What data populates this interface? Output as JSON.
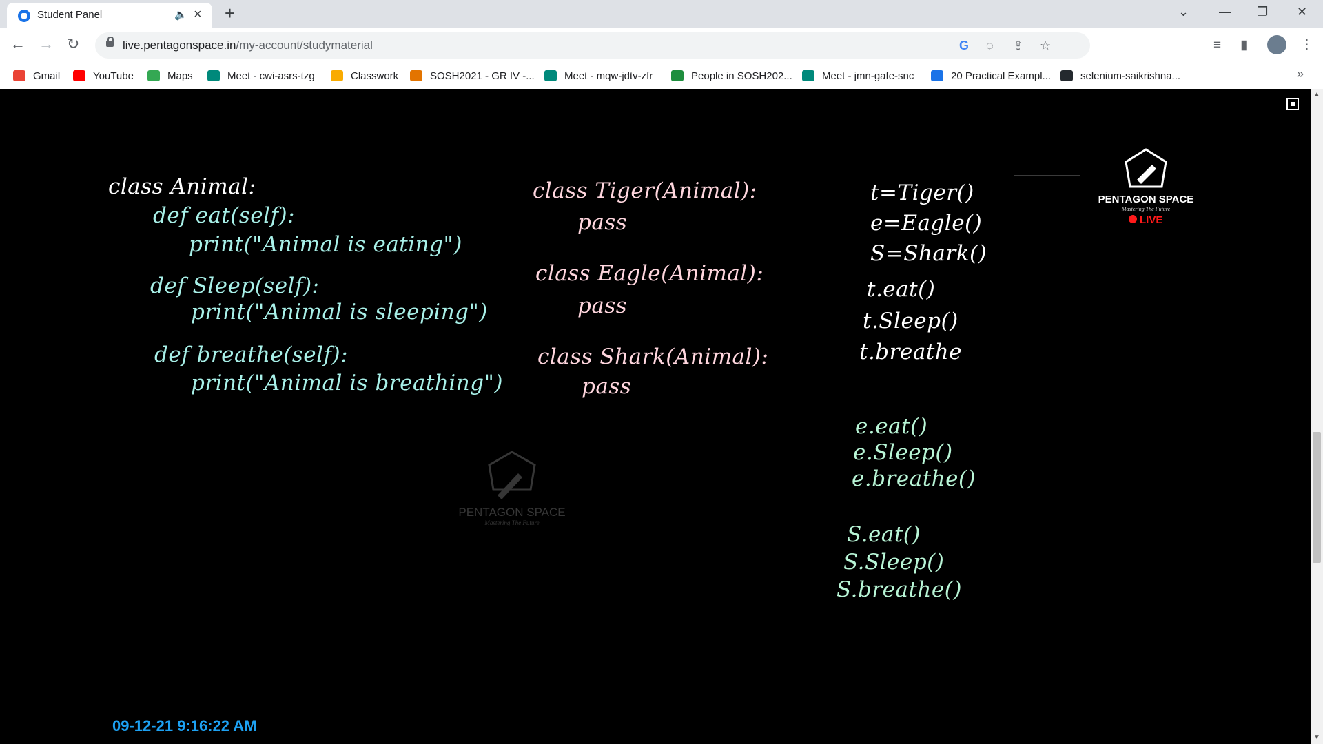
{
  "tab": {
    "title": "Student Panel"
  },
  "address_bar": {
    "domain": "live.pentagonspace.in",
    "path": "/my-account/studymaterial"
  },
  "bookmarks": [
    {
      "label": "Gmail",
      "icon": "gmail-icon",
      "color": "#ea4335"
    },
    {
      "label": "YouTube",
      "icon": "youtube-icon",
      "color": "#ff0000"
    },
    {
      "label": "Maps",
      "icon": "maps-icon",
      "color": "#34a853"
    },
    {
      "label": "Meet - cwi-asrs-tzg",
      "icon": "meet-icon",
      "color": "#00897b"
    },
    {
      "label": "Classwork",
      "icon": "classroom-icon",
      "color": "#f9ab00"
    },
    {
      "label": "SOSH2021 - GR IV -...",
      "icon": "classroom-icon",
      "color": "#e37400"
    },
    {
      "label": "Meet - mqw-jdtv-zfr",
      "icon": "meet-icon",
      "color": "#00897b"
    },
    {
      "label": "People in SOSH202...",
      "icon": "classroom-icon",
      "color": "#1e8e3e"
    },
    {
      "label": "Meet - jmn-gafe-snc",
      "icon": "meet-icon",
      "color": "#00897b"
    },
    {
      "label": "20 Practical Exampl...",
      "icon": "shield-icon",
      "color": "#1a73e8"
    },
    {
      "label": "selenium-saikrishna...",
      "icon": "github-icon",
      "color": "#24292e"
    }
  ],
  "board": {
    "col1": [
      "class Animal:",
      "def eat(self):",
      "print(\"Animal is eating\")",
      "def Sleep(self):",
      "print(\"Animal is sleeping\")",
      "def breathe(self):",
      "print(\"Animal is breathing\")"
    ],
    "col2": [
      "class Tiger(Animal):",
      "pass",
      "class Eagle(Animal):",
      "pass",
      "class Shark(Animal):",
      "pass"
    ],
    "col3": [
      "t=Tiger()",
      "e=Eagle()",
      "S=Shark()",
      "t.eat()",
      "t.Sleep()",
      "t.breathe",
      "e.eat()",
      "e.Sleep()",
      "e.breathe()",
      "S.eat()",
      "S.Sleep()",
      "S.breathe()"
    ]
  },
  "logo": {
    "name": "PENTAGON SPACE",
    "tagline": "Mastering The Future",
    "live": "LIVE"
  },
  "watermark": {
    "name": "PENTAGON SPACE",
    "tagline": "Mastering The Future"
  },
  "timestamp": "09-12-21 9:16:22 AM",
  "colors": {
    "chalk_white": "#ffffff",
    "chalk_cyan": "#a8f0e8",
    "chalk_pink": "#ffd6de",
    "chalk_green": "#b8f5d6",
    "live_red": "#ff1a1a",
    "timestamp": "#1da1f2"
  }
}
